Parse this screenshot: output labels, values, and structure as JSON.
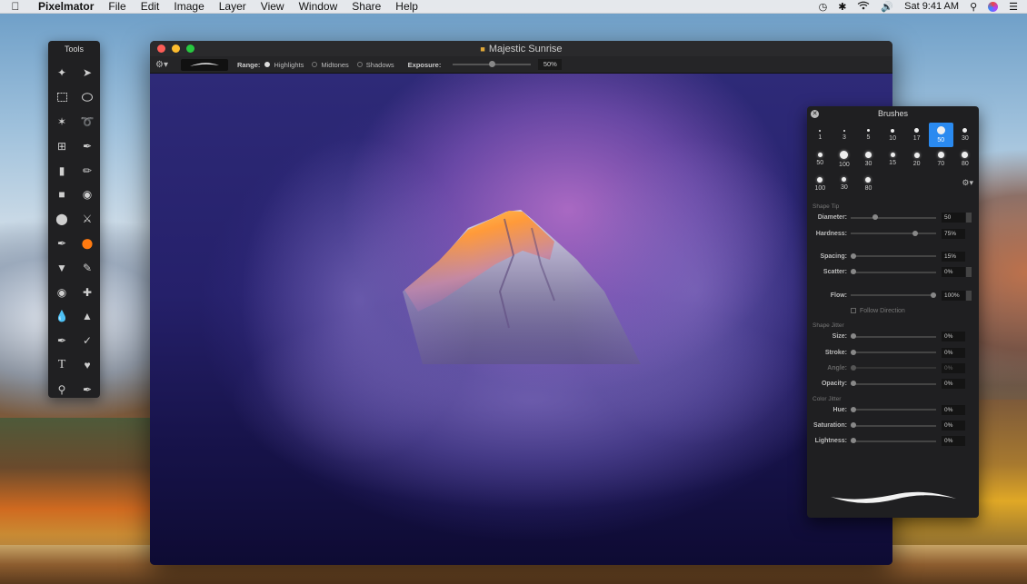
{
  "menubar": {
    "app_name": "Pixelmator",
    "items": [
      "File",
      "Edit",
      "Image",
      "Layer",
      "View",
      "Window",
      "Share",
      "Help"
    ],
    "clock": "Sat 9:41 AM"
  },
  "tools": {
    "title": "Tools"
  },
  "window": {
    "title": "Majestic Sunrise",
    "toolbar": {
      "range_label": "Range:",
      "range_options": [
        "Highlights",
        "Midtones",
        "Shadows"
      ],
      "range_selected": "Highlights",
      "exposure_label": "Exposure:",
      "exposure_value": "50%",
      "exposure_level": 0.5
    }
  },
  "brushes": {
    "title": "Brushes",
    "sizes": [
      "1",
      "3",
      "5",
      "10",
      "17",
      "50",
      "30",
      "50",
      "100",
      "30",
      "15",
      "20",
      "70",
      "80",
      "100",
      "30",
      "80"
    ],
    "selected_index": 5,
    "shape_tip_label": "Shape Tip",
    "diameter_label": "Diameter:",
    "diameter_value": "50",
    "hardness_label": "Hardness:",
    "hardness_value": "75%",
    "spacing_label": "Spacing:",
    "spacing_value": "15%",
    "scatter_label": "Scatter:",
    "scatter_value": "0%",
    "flow_label": "Flow:",
    "flow_value": "100%",
    "follow_direction_label": "Follow Direction",
    "shape_jitter_label": "Shape Jitter",
    "size_label": "Size:",
    "size_value": "0%",
    "stroke_label": "Stroke:",
    "stroke_value": "0%",
    "angle_label": "Angle:",
    "angle_value": "0%",
    "opacity_label": "Opacity:",
    "opacity_value": "0%",
    "color_jitter_label": "Color Jitter",
    "hue_label": "Hue:",
    "hue_value": "0%",
    "saturation_label": "Saturation:",
    "saturation_value": "0%",
    "lightness_label": "Lightness:",
    "lightness_value": "0%"
  }
}
